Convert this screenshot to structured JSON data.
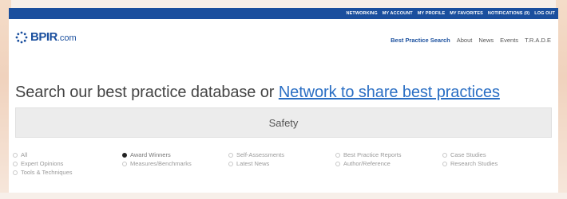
{
  "topnav": {
    "items": [
      "NETWORKING",
      "MY ACCOUNT",
      "MY PROFILE",
      "MY FAVORITES",
      "NOTIFICATIONS (0)",
      "LOG OUT"
    ]
  },
  "logo": {
    "name": "BPIR",
    "suffix": ".com"
  },
  "mainnav": {
    "items": [
      "Best Practice Search",
      "About",
      "News",
      "Events",
      "T.R.A.D.E"
    ]
  },
  "headline": {
    "text": "Search our best practice database or ",
    "link": "Network to share best practices"
  },
  "search": {
    "value": "Safety"
  },
  "filters": {
    "options": [
      {
        "label": "All",
        "checked": false
      },
      {
        "label": "Award Winners",
        "checked": true
      },
      {
        "label": "Self-Assessments",
        "checked": false
      },
      {
        "label": "Best Practice Reports",
        "checked": false
      },
      {
        "label": "Case Studies",
        "checked": false
      },
      {
        "label": "Expert Opinions",
        "checked": false
      },
      {
        "label": "Measures/Benchmarks",
        "checked": false
      },
      {
        "label": "Latest News",
        "checked": false
      },
      {
        "label": "Author/Reference",
        "checked": false
      },
      {
        "label": "Research Studies",
        "checked": false
      },
      {
        "label": "Tools & Techniques",
        "checked": false
      }
    ]
  },
  "colors": {
    "brand": "#1a4f9e",
    "link": "#2b6fc4",
    "search_bg": "#ececec"
  }
}
